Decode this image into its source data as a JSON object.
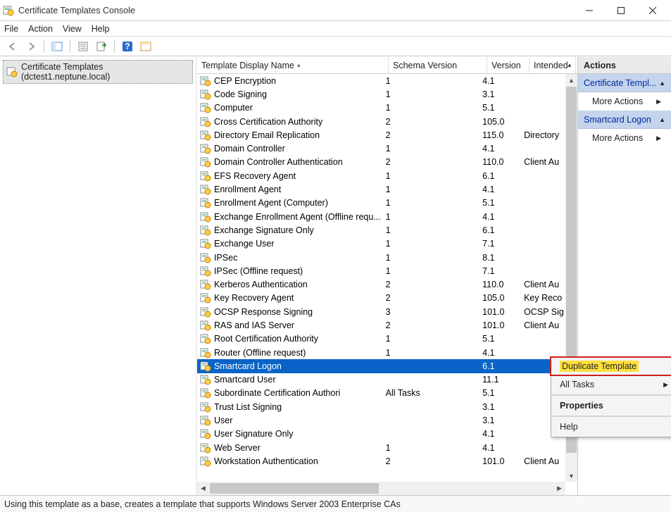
{
  "window": {
    "title": "Certificate Templates Console"
  },
  "menubar": [
    "File",
    "Action",
    "View",
    "Help"
  ],
  "tree": {
    "root": "Certificate Templates (dctest1.neptune.local)"
  },
  "columns": {
    "name": "Template Display Name",
    "schema": "Schema Version",
    "version": "Version",
    "intended": "Intended"
  },
  "rows": [
    {
      "name": "CEP Encryption",
      "schema": "1",
      "version": "4.1",
      "intended": ""
    },
    {
      "name": "Code Signing",
      "schema": "1",
      "version": "3.1",
      "intended": ""
    },
    {
      "name": "Computer",
      "schema": "1",
      "version": "5.1",
      "intended": ""
    },
    {
      "name": "Cross Certification Authority",
      "schema": "2",
      "version": "105.0",
      "intended": ""
    },
    {
      "name": "Directory Email Replication",
      "schema": "2",
      "version": "115.0",
      "intended": "Directory"
    },
    {
      "name": "Domain Controller",
      "schema": "1",
      "version": "4.1",
      "intended": ""
    },
    {
      "name": "Domain Controller Authentication",
      "schema": "2",
      "version": "110.0",
      "intended": "Client Au"
    },
    {
      "name": "EFS Recovery Agent",
      "schema": "1",
      "version": "6.1",
      "intended": ""
    },
    {
      "name": "Enrollment Agent",
      "schema": "1",
      "version": "4.1",
      "intended": ""
    },
    {
      "name": "Enrollment Agent (Computer)",
      "schema": "1",
      "version": "5.1",
      "intended": ""
    },
    {
      "name": "Exchange Enrollment Agent (Offline requ...",
      "schema": "1",
      "version": "4.1",
      "intended": ""
    },
    {
      "name": "Exchange Signature Only",
      "schema": "1",
      "version": "6.1",
      "intended": ""
    },
    {
      "name": "Exchange User",
      "schema": "1",
      "version": "7.1",
      "intended": ""
    },
    {
      "name": "IPSec",
      "schema": "1",
      "version": "8.1",
      "intended": ""
    },
    {
      "name": "IPSec (Offline request)",
      "schema": "1",
      "version": "7.1",
      "intended": ""
    },
    {
      "name": "Kerberos Authentication",
      "schema": "2",
      "version": "110.0",
      "intended": "Client Au"
    },
    {
      "name": "Key Recovery Agent",
      "schema": "2",
      "version": "105.0",
      "intended": "Key Reco"
    },
    {
      "name": "OCSP Response Signing",
      "schema": "3",
      "version": "101.0",
      "intended": "OCSP Sig"
    },
    {
      "name": "RAS and IAS Server",
      "schema": "2",
      "version": "101.0",
      "intended": "Client Au"
    },
    {
      "name": "Root Certification Authority",
      "schema": "1",
      "version": "5.1",
      "intended": ""
    },
    {
      "name": "Router (Offline request)",
      "schema": "1",
      "version": "4.1",
      "intended": ""
    },
    {
      "name": "Smartcard Logon",
      "schema": "",
      "version": "6.1",
      "intended": "",
      "selected": true
    },
    {
      "name": "Smartcard User",
      "schema": "",
      "version": "11.1",
      "intended": ""
    },
    {
      "name": "Subordinate Certification Authori",
      "schema": "All Tasks",
      "version": "5.1",
      "intended": ""
    },
    {
      "name": "Trust List Signing",
      "schema": "",
      "version": "3.1",
      "intended": ""
    },
    {
      "name": "User",
      "schema": "",
      "version": "3.1",
      "intended": ""
    },
    {
      "name": "User Signature Only",
      "schema": "",
      "version": "4.1",
      "intended": ""
    },
    {
      "name": "Web Server",
      "schema": "1",
      "version": "4.1",
      "intended": ""
    },
    {
      "name": "Workstation Authentication",
      "schema": "2",
      "version": "101.0",
      "intended": "Client Au"
    }
  ],
  "context_menu": {
    "duplicate": "Duplicate Template",
    "all_tasks": "All Tasks",
    "properties": "Properties",
    "help": "Help"
  },
  "actions_pane": {
    "header": "Actions",
    "section1": "Certificate Templ...",
    "more_actions": "More Actions",
    "section2": "Smartcard Logon"
  },
  "statusbar": "Using this template as a base, creates a template that supports Windows Server 2003 Enterprise CAs"
}
